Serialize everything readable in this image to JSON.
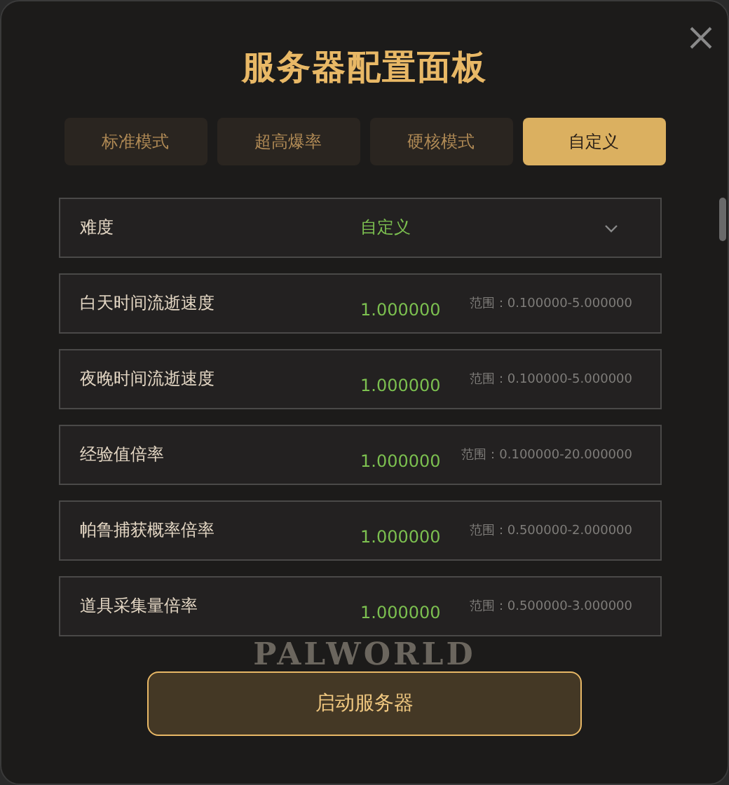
{
  "window": {
    "title": "服务器配置面板"
  },
  "tabs": [
    {
      "label": "标准模式",
      "selected": false
    },
    {
      "label": "超高爆率",
      "selected": false
    },
    {
      "label": "硬核模式",
      "selected": false
    },
    {
      "label": "自定义",
      "selected": true
    }
  ],
  "settings": [
    {
      "kind": "select",
      "label": "难度",
      "value": "自定义"
    },
    {
      "kind": "number",
      "label": "白天时间流逝速度",
      "value": "1.000000",
      "range": "范围：0.100000-5.000000"
    },
    {
      "kind": "number",
      "label": "夜晚时间流逝速度",
      "value": "1.000000",
      "range": "范围：0.100000-5.000000"
    },
    {
      "kind": "number",
      "label": "经验值倍率",
      "value": "1.000000",
      "range": "范围：0.100000-20.000000"
    },
    {
      "kind": "number",
      "label": "帕鲁捕获概率倍率",
      "value": "1.000000",
      "range": "范围：0.500000-2.000000"
    },
    {
      "kind": "number",
      "label": "道具采集量倍率",
      "value": "1.000000",
      "range": "范围：0.500000-3.000000"
    }
  ],
  "background_logo": "PALWORLD",
  "start_button": "启动服务器"
}
